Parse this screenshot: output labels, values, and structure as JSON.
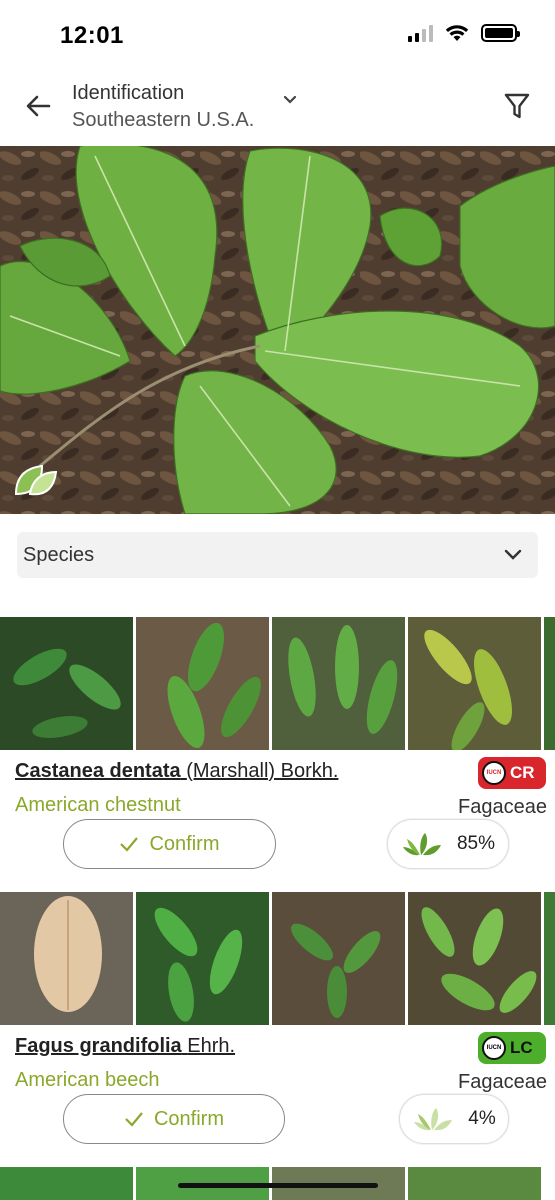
{
  "status_bar": {
    "time": "12:01"
  },
  "header": {
    "title": "Identification",
    "subtitle": "Southeastern U.S.A."
  },
  "filter": {
    "selected": "Species"
  },
  "results": [
    {
      "scientific_name": "Castanea dentata",
      "author": "(Marshall) Borkh.",
      "common_name": "American chestnut",
      "family": "Fagaceae",
      "iucn_logo": "IUCN",
      "iucn_status": "CR",
      "iucn_color": "#d8262c",
      "confirm_label": "Confirm",
      "score": "85%",
      "score_level": 0.85
    },
    {
      "scientific_name": "Fagus grandifolia",
      "author": "Ehrh.",
      "common_name": "American beech",
      "family": "Fagaceae",
      "iucn_logo": "IUCN",
      "iucn_status": "LC",
      "iucn_color": "#4cae2a",
      "confirm_label": "Confirm",
      "score": "4%",
      "score_level": 0.04
    }
  ],
  "colors": {
    "accent_green": "#8aa82a",
    "leaf_green": "#6aa33a"
  },
  "icons": [
    "back-arrow-icon",
    "chevron-down-icon",
    "filter-icon",
    "check-icon",
    "leaf-score-icon",
    "leaf-badge-icon",
    "signal-icon",
    "wifi-icon",
    "battery-icon"
  ]
}
